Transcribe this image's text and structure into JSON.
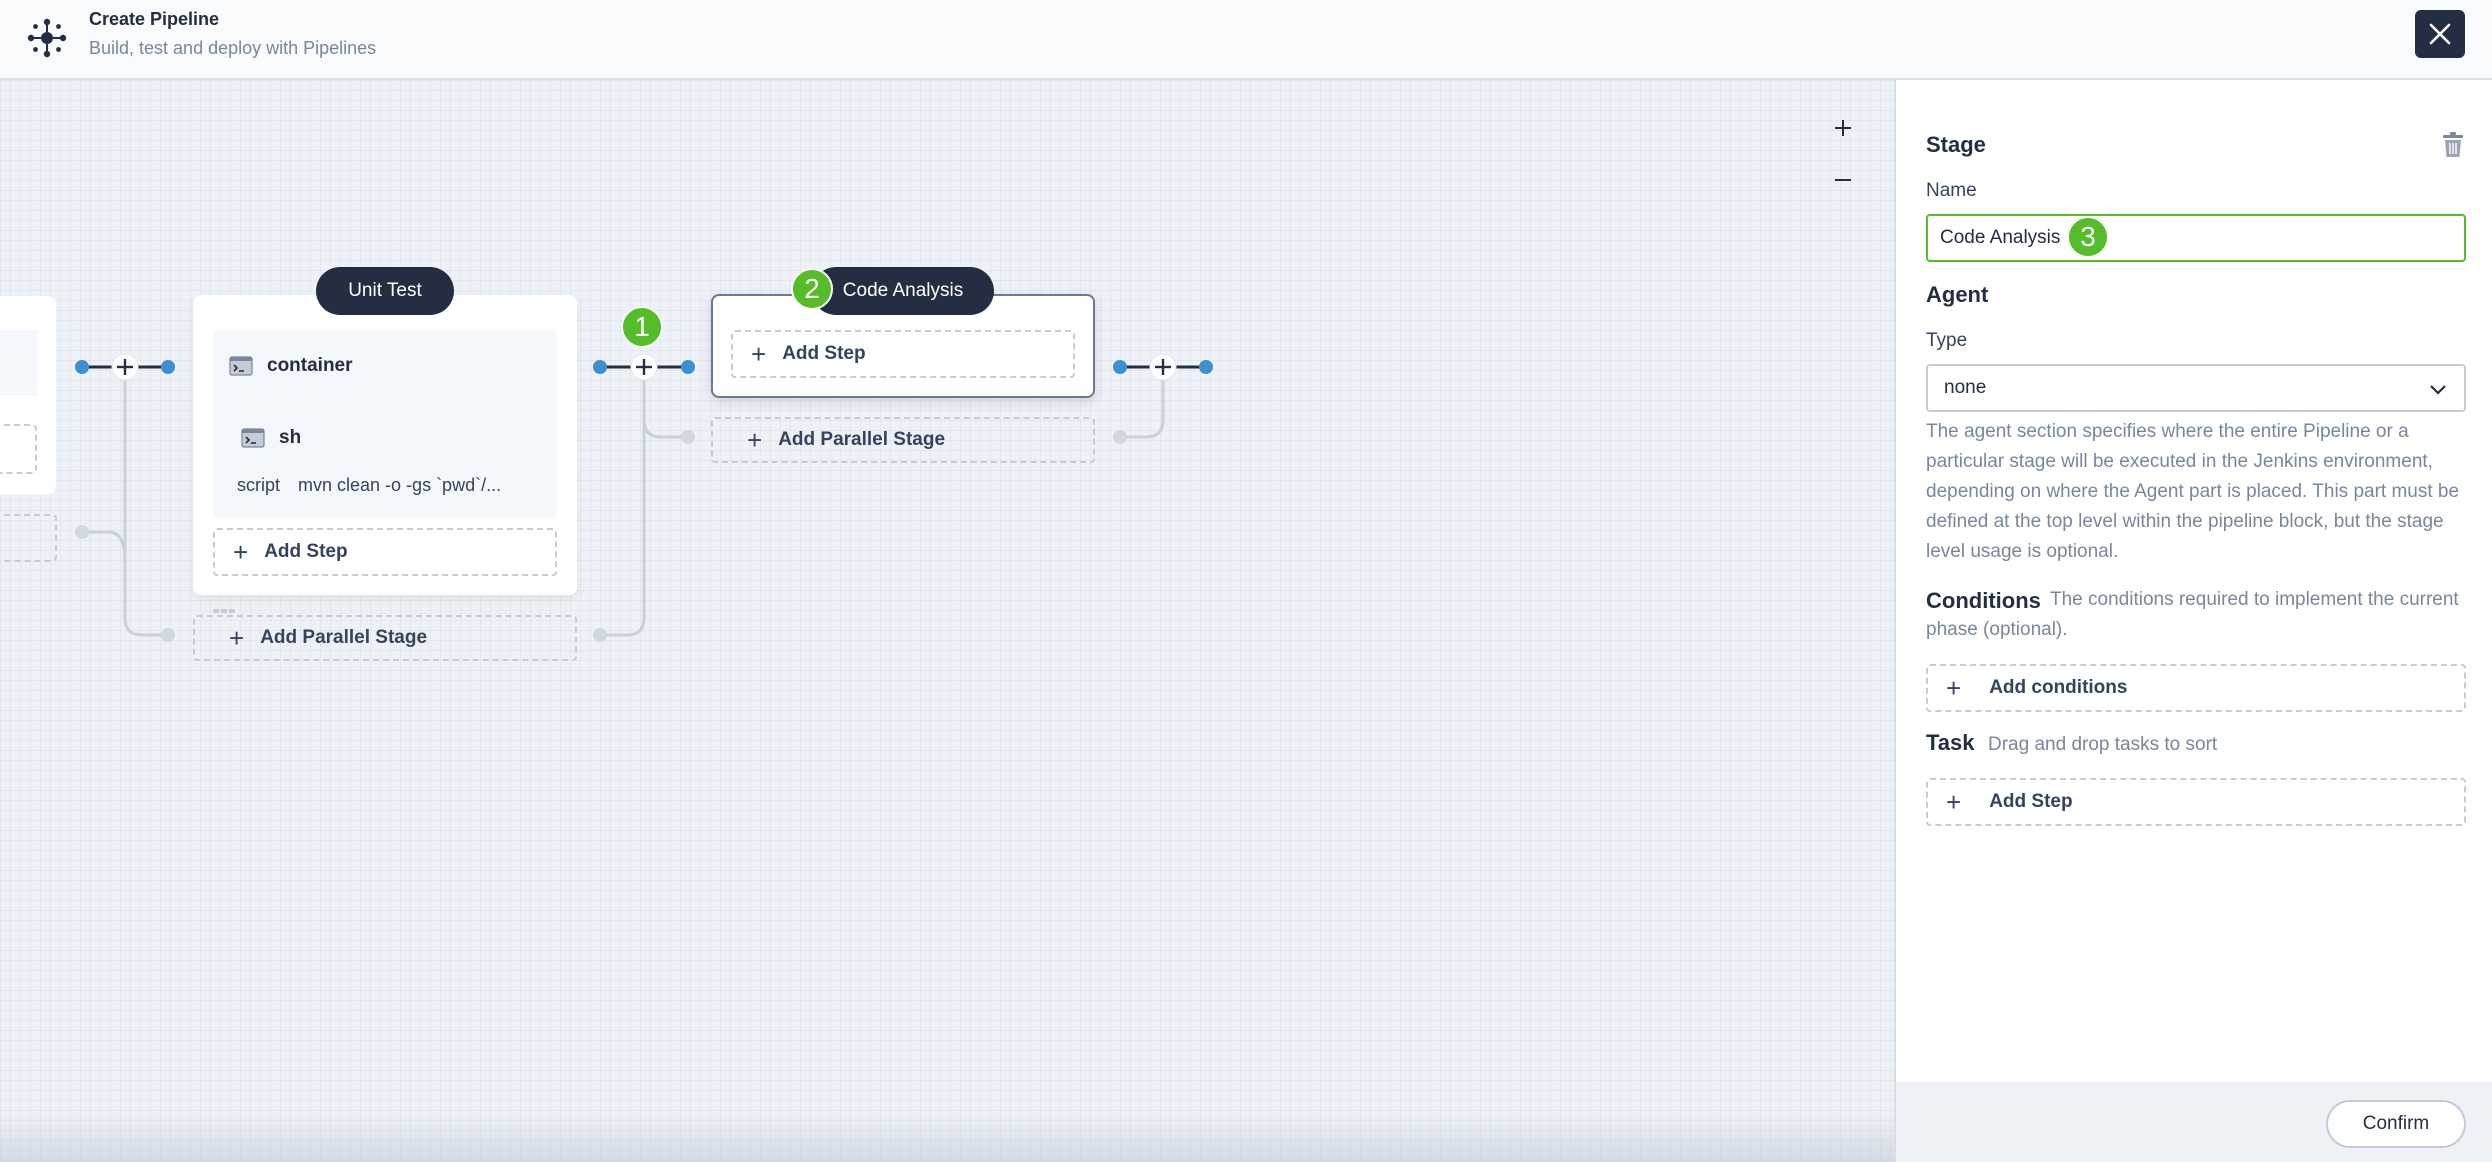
{
  "header": {
    "title": "Create Pipeline",
    "subtitle": "Build, test and deploy with Pipelines",
    "icons": {
      "logo": "pipeline-graph-icon",
      "close": "close-icon"
    }
  },
  "canvas": {
    "zoom_in": "+",
    "zoom_out": "−",
    "stages": [
      {
        "name": "Unit Test",
        "steps": [
          {
            "type": "container",
            "icon": "terminal-icon",
            "children": [
              {
                "type": "sh",
                "icon": "terminal-icon",
                "script_key": "script",
                "script_value": "mvn clean -o -gs `pwd`/..."
              }
            ]
          }
        ],
        "add_step_label": "Add Step",
        "add_parallel_label": "Add Parallel Stage"
      },
      {
        "name": "Code Analysis",
        "selected": true,
        "add_step_label": "Add Step",
        "add_parallel_label": "Add Parallel Stage"
      }
    ],
    "badges": [
      "1",
      "2",
      "3"
    ]
  },
  "panel": {
    "stage_heading": "Stage",
    "name_label": "Name",
    "name_value": "Code Analysis",
    "agent_heading": "Agent",
    "type_label": "Type",
    "type_value": "none",
    "agent_description": "The agent section specifies where the entire Pipeline or a particular stage will be executed in the Jenkins environment, depending on where the Agent part is placed. This part must be defined at the top level within the pipeline block, but the stage level usage is optional.",
    "conditions_heading": "Conditions",
    "conditions_hint": "The conditions required to implement the current phase (optional).",
    "add_conditions_label": "Add conditions",
    "task_heading": "Task",
    "task_hint": "Drag and drop tasks to sort",
    "add_step_label": "Add Step",
    "confirm_label": "Confirm"
  },
  "colors": {
    "dark": "#242e42",
    "accent_green": "#55bc2a",
    "node_blue": "#3f8fd0",
    "muted_text": "#79879c"
  }
}
